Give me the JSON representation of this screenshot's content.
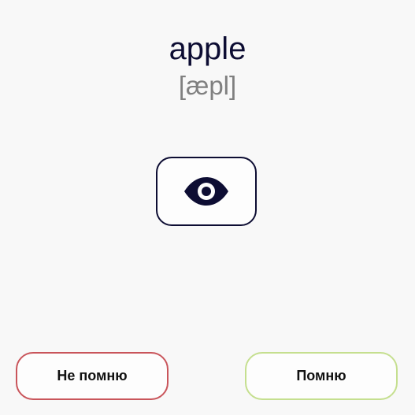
{
  "card": {
    "word": "apple",
    "transcription": "[æpl]"
  },
  "reveal": {
    "icon": "eye-icon"
  },
  "actions": {
    "forgot_label": "Не помню",
    "remember_label": "Помню"
  },
  "colors": {
    "text_primary": "#0d0d33",
    "text_secondary": "#808080",
    "forgot_border": "#c9555b",
    "remember_border": "#c5df8f",
    "background": "#f8f8f8"
  }
}
